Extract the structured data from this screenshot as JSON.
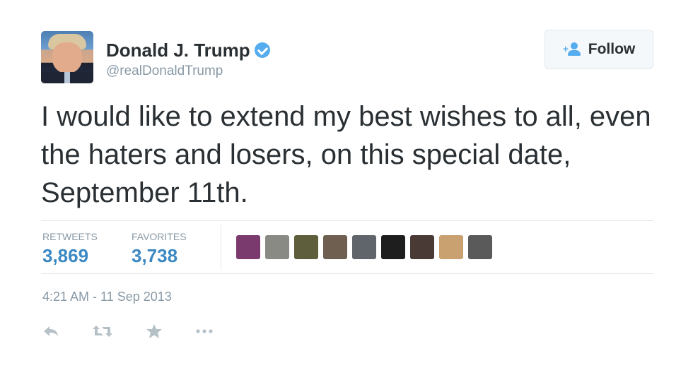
{
  "user": {
    "name": "Donald J. Trump",
    "handle": "@realDonaldTrump"
  },
  "follow_button": {
    "label": "Follow",
    "icon": "add-user-icon"
  },
  "tweet": {
    "text": "I would like to extend my best wishes to all, even the haters and losers, on this special date, September 11th.",
    "timestamp": "4:21 AM - 11 Sep 2013"
  },
  "stats": {
    "retweets_label": "RETWEETS",
    "retweets_count": "3,869",
    "favorites_label": "FAVORITES",
    "favorites_count": "3,738"
  },
  "favoriter_avatars": [
    {
      "color": "#7a3a6e"
    },
    {
      "color": "#8a8a84"
    },
    {
      "color": "#5e5e3c"
    },
    {
      "color": "#6e5f50"
    },
    {
      "color": "#60656c"
    },
    {
      "color": "#1e1e1e"
    },
    {
      "color": "#4a3a36"
    },
    {
      "color": "#c9a070"
    },
    {
      "color": "#5a5a5a"
    }
  ],
  "actions": [
    "reply-icon",
    "retweet-icon",
    "favorite-star-icon",
    "more-options-icon"
  ],
  "colors": {
    "verified": "#55acee",
    "stat_value": "#3b88c3",
    "muted_text": "#8899a6",
    "body_text": "#292f33",
    "border": "#e1e8ed"
  }
}
